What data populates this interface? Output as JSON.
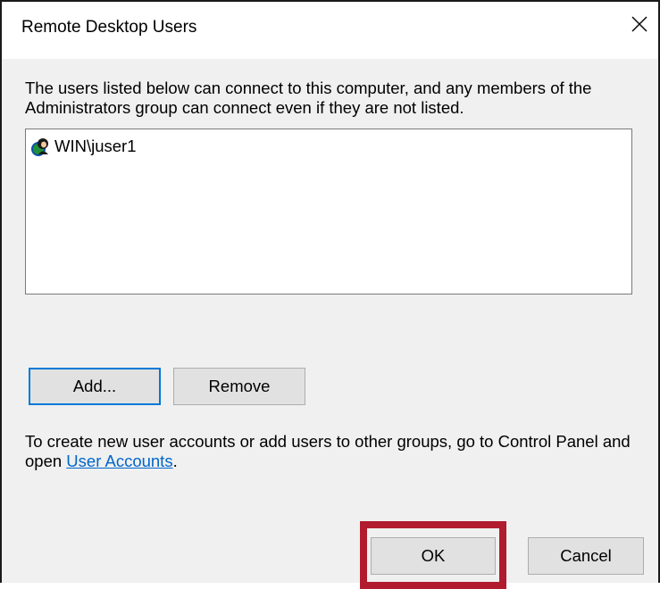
{
  "window": {
    "title": "Remote Desktop Users",
    "close_icon": "close-icon"
  },
  "intro_text": "The users listed below can connect to this computer, and any members of the Administrators group can connect even if they are not listed.",
  "users": [
    {
      "name": "WIN\\juser1",
      "icon": "user-icon"
    }
  ],
  "buttons": {
    "add": "Add...",
    "remove": "Remove",
    "ok": "OK",
    "cancel": "Cancel"
  },
  "help": {
    "prefix": "To create new user accounts or add users to other groups, go to Control Panel and open ",
    "link": "User Accounts",
    "suffix": "."
  },
  "colors": {
    "highlight": "#b01c2e",
    "focus": "#0078d7",
    "link": "#0066cc"
  }
}
